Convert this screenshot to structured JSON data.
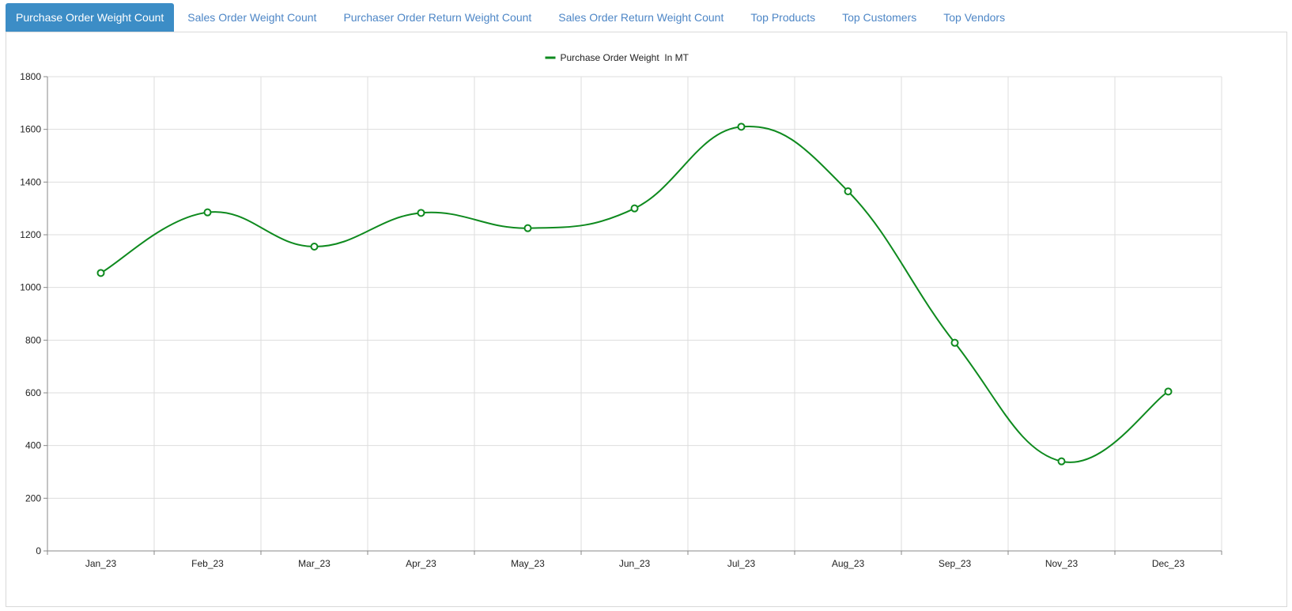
{
  "tabs": [
    {
      "label": "Purchase Order Weight Count",
      "active": true
    },
    {
      "label": "Sales Order Weight Count",
      "active": false
    },
    {
      "label": "Purchaser Order Return Weight Count",
      "active": false
    },
    {
      "label": "Sales Order Return Weight Count",
      "active": false
    },
    {
      "label": "Top Products",
      "active": false
    },
    {
      "label": "Top Customers",
      "active": false
    },
    {
      "label": "Top Vendors",
      "active": false
    }
  ],
  "colors": {
    "accent": "#3c8dc6",
    "tab_text": "#4d86c6",
    "series": "#0e8a1e",
    "grid": "#dddddd"
  },
  "chart_data": {
    "type": "line",
    "categories": [
      "Jan_23",
      "Feb_23",
      "Mar_23",
      "Apr_23",
      "May_23",
      "Jun_23",
      "Jul_23",
      "Aug_23",
      "Sep_23",
      "Nov_23",
      "Dec_23"
    ],
    "series": [
      {
        "name": "Purchase Order Weight  In MT",
        "values": [
          1055,
          1285,
          1155,
          1283,
          1225,
          1300,
          1610,
          1365,
          790,
          340,
          605
        ],
        "color": "#0e8a1e"
      }
    ],
    "yticks": [
      0,
      200,
      400,
      600,
      800,
      1000,
      1200,
      1400,
      1600,
      1800
    ],
    "ylim": [
      0,
      1800
    ],
    "grid": true,
    "legend": "top-center",
    "smooth": true
  }
}
